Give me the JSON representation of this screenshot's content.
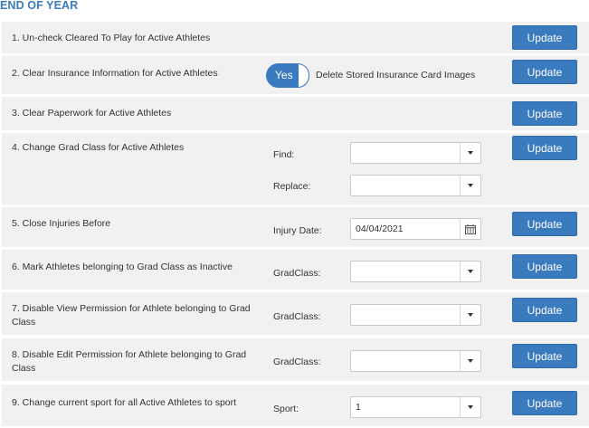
{
  "section": {
    "title": "END OF YEAR"
  },
  "rows": [
    {
      "label": "1. Un-check Cleared To Play for Active Athletes",
      "button": "Update"
    },
    {
      "label": "2. Clear Insurance Information for Active Athletes",
      "button": "Update",
      "toggle": {
        "state_label": "Yes",
        "on": true
      },
      "toggle_text": "Delete Stored Insurance Card Images"
    },
    {
      "label": "3. Clear Paperwork for Active Athletes",
      "button": "Update"
    },
    {
      "label": "4. Change Grad Class for Active Athletes",
      "button": "Update",
      "fields": [
        {
          "label": "Find:",
          "value": ""
        },
        {
          "label": "Replace:",
          "value": ""
        }
      ]
    },
    {
      "label": "5. Close Injuries Before",
      "button": "Update",
      "fields": [
        {
          "label": "Injury Date:",
          "value": "04/04/2021"
        }
      ]
    },
    {
      "label": "6. Mark Athletes belonging to Grad Class as Inactive",
      "button": "Update",
      "fields": [
        {
          "label": "GradClass:",
          "value": ""
        }
      ]
    },
    {
      "label": "7. Disable View Permission for Athlete belonging to Grad Class",
      "button": "Update",
      "fields": [
        {
          "label": "GradClass:",
          "value": ""
        }
      ]
    },
    {
      "label": "8. Disable Edit Permission for Athlete belonging to Grad Class",
      "button": "Update",
      "fields": [
        {
          "label": "GradClass:",
          "value": ""
        }
      ]
    },
    {
      "label": "9. Change current sport for all Active Athletes to sport",
      "button": "Update",
      "fields": [
        {
          "label": "Sport:",
          "value": "1"
        }
      ]
    }
  ],
  "colors": {
    "accent": "#3a7bbf",
    "row_bg": "#f1f1f1"
  },
  "icons": {
    "dropdown": "caret-down-icon",
    "date": "calendar-icon"
  }
}
